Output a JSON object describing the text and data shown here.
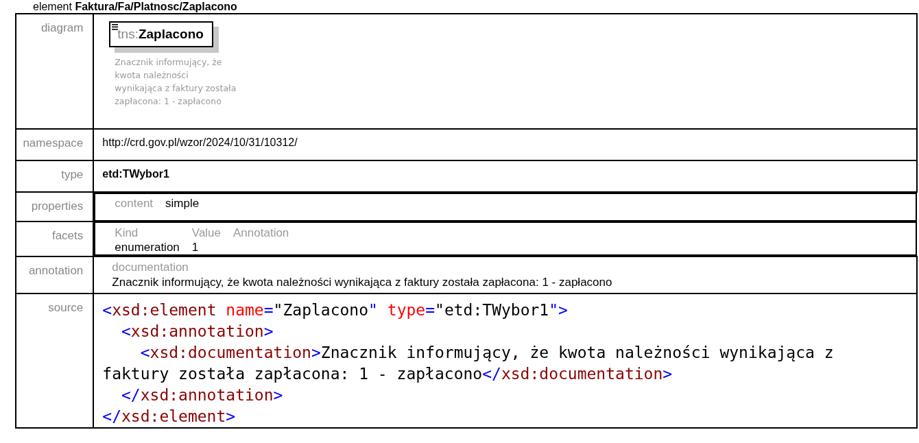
{
  "heading": "element **Faktura/Fa/Platnosc/Zaplacono**",
  "rows": [
    {
      "kind": "diagram",
      "label": "diagram",
      "element": {
        "prefix": "tns:",
        "name": "Zaplacono"
      },
      "note_lines": [
        "Znacznik informujący, że",
        "kwota należności",
        "wynikająca z faktury została",
        "zapłacona: 1 - zapłacono"
      ]
    },
    {
      "kind": "text",
      "label": "namespace",
      "value": "http://crd.gov.pl/wzor/2024/10/31/10312/",
      "bold": false
    },
    {
      "kind": "text",
      "label": "type",
      "value": "etd:TWybor1",
      "bold": true
    },
    {
      "kind": "pairs",
      "label": "properties",
      "pairs": [
        {
          "key": "content",
          "value": "simple"
        }
      ]
    },
    {
      "kind": "grid",
      "label": "facets",
      "columns": [
        "Kind",
        "Value",
        "Annotation"
      ],
      "cells": [
        "enumeration",
        "1"
      ]
    },
    {
      "kind": "doc",
      "label": "annotation",
      "caption": "documentation",
      "value": "Znacznik informujący, że kwota należności wynikająca z faktury została zapłacona: 1 - zapłacono"
    },
    {
      "kind": "code",
      "label": "source",
      "lines": [
        [
          {
            "kind": "bracket",
            "text": "<"
          },
          {
            "kind": "tag",
            "text": "xsd:element"
          },
          {
            "kind": "attr",
            "text": " name"
          },
          {
            "kind": "bracket",
            "text": "="
          },
          {
            "kind": "plain",
            "text": "\"Zaplacono"
          },
          {
            "kind": "bracket",
            "text": "\""
          },
          {
            "kind": "attr",
            "text": " type"
          },
          {
            "kind": "bracket",
            "text": "="
          },
          {
            "kind": "plain",
            "text": "\"etd:TWybor1"
          },
          {
            "kind": "bracket",
            "text": "\">"
          }
        ],
        [
          {
            "kind": "bracket",
            "text": "  <"
          },
          {
            "kind": "tag",
            "text": "xsd:annotation"
          },
          {
            "kind": "bracket",
            "text": ">"
          }
        ],
        [
          {
            "kind": "bracket",
            "text": "    <"
          },
          {
            "kind": "tag",
            "text": "xsd:documentation"
          },
          {
            "kind": "bracket",
            "text": ">"
          },
          {
            "kind": "plain",
            "text": "Znacznik informujący, że kwota należności wynikająca z"
          }
        ],
        [
          {
            "kind": "plain",
            "text": "faktury została zapłacona: 1 - zapłacono"
          },
          {
            "kind": "bracket",
            "text": "</"
          },
          {
            "kind": "tag",
            "text": "xsd:documentation"
          },
          {
            "kind": "bracket",
            "text": ">"
          }
        ],
        [
          {
            "kind": "bracket",
            "text": "  </"
          },
          {
            "kind": "tag",
            "text": "xsd:annotation"
          },
          {
            "kind": "bracket",
            "text": ">"
          }
        ],
        [
          {
            "kind": "bracket",
            "text": "</"
          },
          {
            "kind": "tag",
            "text": "xsd:element"
          },
          {
            "kind": "bracket",
            "text": ">"
          }
        ]
      ]
    }
  ]
}
